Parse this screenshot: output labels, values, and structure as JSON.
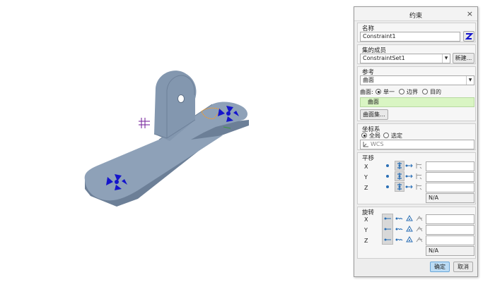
{
  "dialog": {
    "title": "约束",
    "close_glyph": "×",
    "name": {
      "label": "名称",
      "value": "Constraint1"
    },
    "set_member": {
      "label": "集的成员",
      "value": "ConstraintSet1",
      "new_label": "新建..."
    },
    "reference": {
      "label": "参考",
      "type_value": "曲面",
      "surface_label": "曲面:",
      "options": [
        "单一",
        "边界",
        "目的"
      ],
      "selected_option": "单一",
      "collector_value": "曲面",
      "surface_set_button": "曲面集..."
    },
    "csys": {
      "label": "坐标系",
      "options": [
        "全局",
        "选定"
      ],
      "selected_option": "全局",
      "field_value": "WCS"
    },
    "translation": {
      "label": "平移",
      "axes": [
        "X",
        "Y",
        "Z"
      ],
      "na": "N/A"
    },
    "rotation": {
      "label": "旋转",
      "axes": [
        "X",
        "Y",
        "Z"
      ],
      "na": "N/A"
    },
    "ok_label": "确定",
    "cancel_label": "取消"
  },
  "colors": {
    "part_fill": "#7f93ab",
    "part_top": "#8ea1b8",
    "collector_highlight": "#d9f5c3",
    "ok_button": "#bcdcf5",
    "constraint_marker": "#1414cc"
  }
}
